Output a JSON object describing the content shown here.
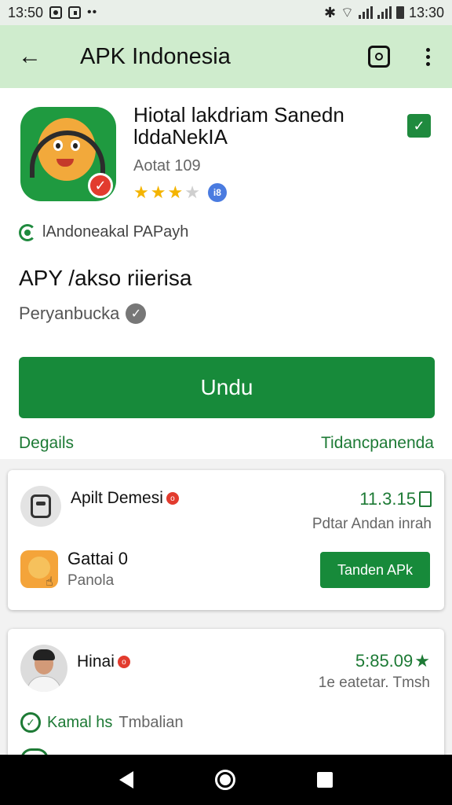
{
  "status_bar": {
    "time": "13:50",
    "right_time": "13:30"
  },
  "app_bar": {
    "title": "APK Indonesia"
  },
  "app": {
    "name_line1": "Hiotal lakdriam Sanedn",
    "name_line2": "lddaNekIA",
    "version": "Aotat 109",
    "rating_stars": 3,
    "rating_max": 4,
    "info_badge": "i8",
    "publisher": "lAndoneakal PAPayh",
    "description_title": "APY /akso riierisa",
    "safety_text": "Peryanbucka"
  },
  "actions": {
    "download_label": "Undu",
    "details_link": "Degails",
    "compare_link": "Tidancpanenda"
  },
  "card1": {
    "title": "Apilt Demesi",
    "size": "11.3.15",
    "subtitle": "Pdtar Andan inrah",
    "app_name": "Gattai 0",
    "app_sub": "Panola",
    "button_label": "Tanden APk"
  },
  "card2": {
    "title": "Hinai",
    "score": "5:85.09",
    "subtitle": "1e eatetar. Tmsh",
    "row_text_a": "Kamal hs",
    "row_text_b": "Tmbalian"
  },
  "colors": {
    "accent": "#178a3a",
    "app_bar": "#cfeccd",
    "badge_red": "#e23b2e",
    "star": "#f4b400"
  }
}
